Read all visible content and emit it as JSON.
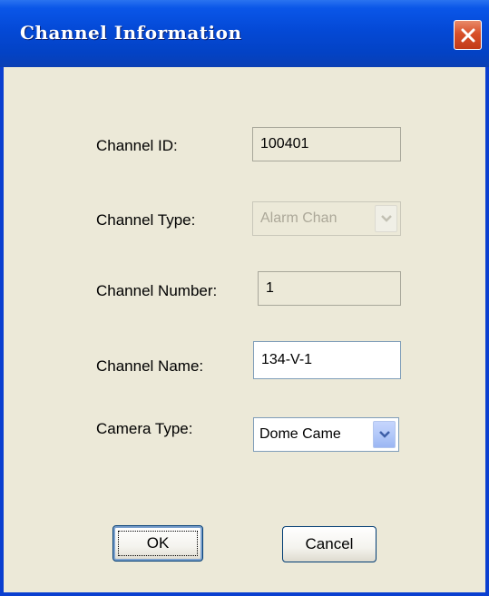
{
  "window": {
    "title": "Channel Information"
  },
  "fields": {
    "channel_id": {
      "label": "Channel ID:",
      "value": "100401"
    },
    "channel_type": {
      "label": "Channel Type:",
      "value": "Alarm Chan"
    },
    "channel_number": {
      "label": "Channel Number:",
      "value": "1"
    },
    "channel_name": {
      "label": "Channel Name:",
      "value": "134-V-1"
    },
    "camera_type": {
      "label": "Camera Type:",
      "value": "Dome Came"
    }
  },
  "buttons": {
    "ok": "OK",
    "cancel": "Cancel"
  },
  "icons": {
    "close": "close-icon",
    "dropdown": "chevron-down-icon"
  },
  "colors": {
    "title_bar": "#0449d6",
    "dialog_bg": "#ece9d8",
    "close_button": "#d8502a"
  }
}
